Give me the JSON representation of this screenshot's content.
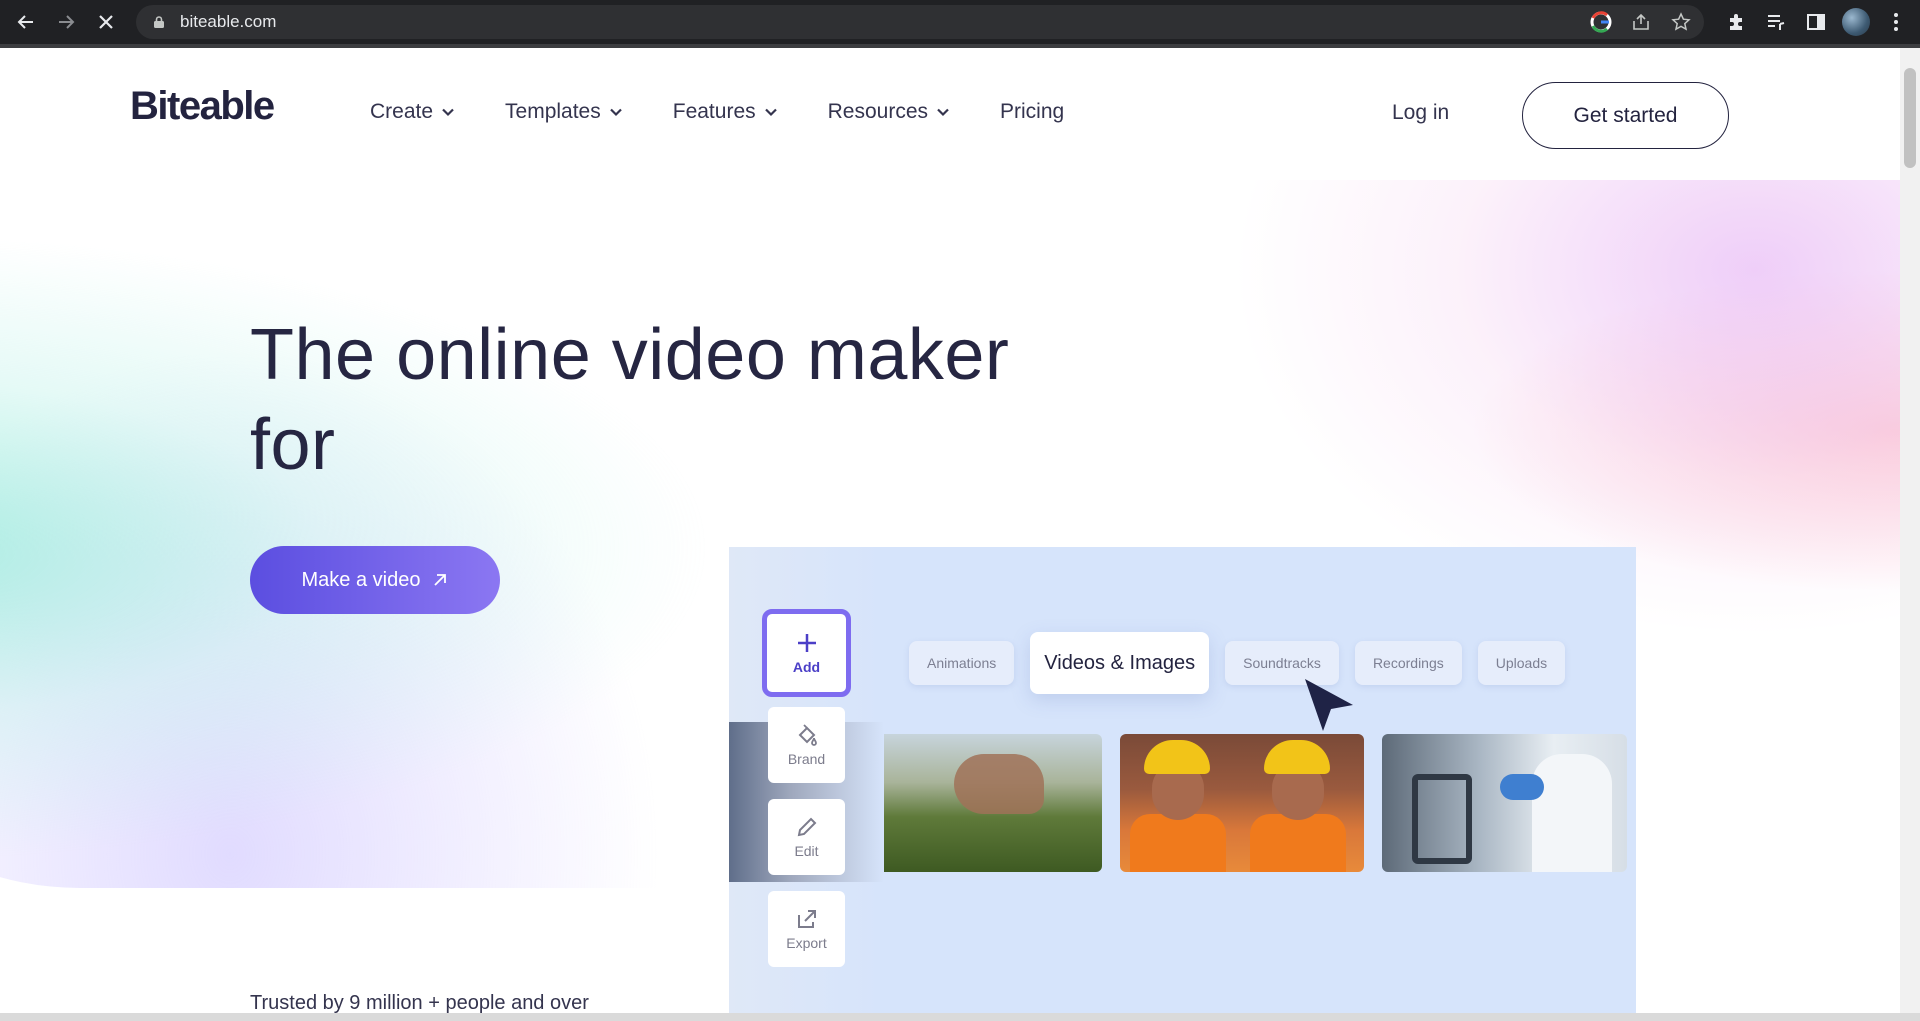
{
  "browser": {
    "url": "biteable.com"
  },
  "nav": {
    "logo": "Biteable",
    "links": [
      {
        "label": "Create"
      },
      {
        "label": "Templates"
      },
      {
        "label": "Features"
      },
      {
        "label": "Resources"
      },
      {
        "label": "Pricing"
      }
    ],
    "login": "Log in",
    "get_started": "Get started"
  },
  "hero": {
    "title_line1": "The online video maker",
    "title_line2": "for",
    "cta": "Make a video",
    "trusted": "Trusted by 9 million + people and over"
  },
  "editor": {
    "tools": [
      {
        "label": "Add",
        "icon": "plus-icon"
      },
      {
        "label": "Brand",
        "icon": "paint-bucket-icon"
      },
      {
        "label": "Edit",
        "icon": "pencil-icon"
      },
      {
        "label": "Export",
        "icon": "export-icon"
      }
    ],
    "tabs": [
      "Animations",
      "Videos & Images",
      "Soundtracks",
      "Recordings",
      "Uploads"
    ],
    "active_tab": "Videos & Images"
  },
  "colors": {
    "primary": "#5b4ee0",
    "text_dark": "#262642",
    "editor_bg": "#d6e4fb"
  }
}
